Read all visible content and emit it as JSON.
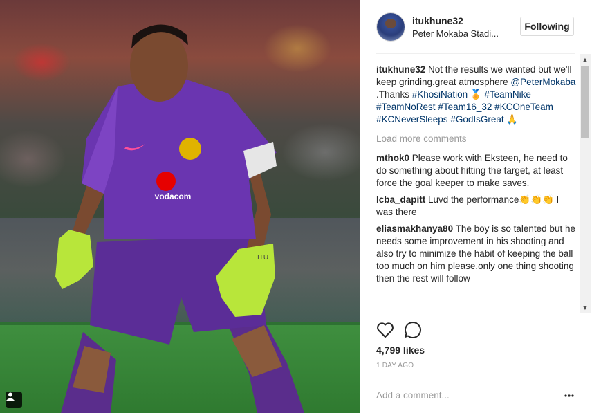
{
  "post": {
    "username": "itukhune32",
    "location": "Peter Mokaba Stadi...",
    "follow_label": "Following"
  },
  "caption": {
    "username": "itukhune32",
    "text1": " Not the results we wanted but we'll keep grinding.great atmosphere ",
    "mention": "@PeterMokaba",
    "text2": " .Thanks ",
    "tags": [
      "#KhosiNation",
      "#TeamNike",
      "#TeamNoRest",
      "#Team16_32",
      "#KCOneTeam",
      "#KCNeverSleeps",
      "#GodIsGreat"
    ]
  },
  "load_more": "Load more comments",
  "comments": [
    {
      "user": "mthok0",
      "text": " Please work with Eksteen, he need to do something about hitting the target, at least force the goal keeper to make saves."
    },
    {
      "user": "lcba_dapitt",
      "text": " Luvd the performance👏👏👏 I was there"
    },
    {
      "user": "eliasmakhanya80",
      "text": " The boy is so talented but he needs some improvement in his shooting and also try to minimize the habit of keeping the ball too much on him please.only one thing shooting then the rest will follow"
    }
  ],
  "likes": "4,799 likes",
  "time_ago": "1 DAY AGO",
  "add_comment_placeholder": "Add a comment...",
  "jersey": {
    "sponsor": "vodacom",
    "sleeve": "ITU"
  },
  "icons": [
    "heart-icon",
    "comment-icon",
    "more-icon",
    "user-tag-icon"
  ]
}
